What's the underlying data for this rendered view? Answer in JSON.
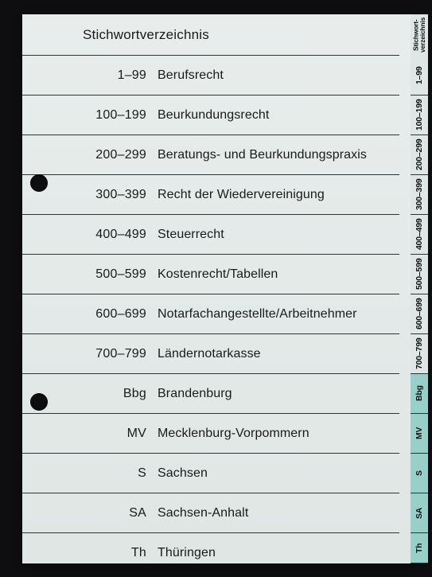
{
  "header": {
    "title": "Stichwortverzeichnis",
    "tab_label": "Stichwort-\nverzeichnis"
  },
  "rows": [
    {
      "code": "1–99",
      "desc": "Berufsrecht",
      "tab": "1–99",
      "region": false
    },
    {
      "code": "100–199",
      "desc": "Beurkundungsrecht",
      "tab": "100–199",
      "region": false
    },
    {
      "code": "200–299",
      "desc": "Beratungs- und Beurkundungspraxis",
      "tab": "200–299",
      "region": false
    },
    {
      "code": "300–399",
      "desc": "Recht der Wiedervereinigung",
      "tab": "300–399",
      "region": false
    },
    {
      "code": "400–499",
      "desc": "Steuerrecht",
      "tab": "400–499",
      "region": false
    },
    {
      "code": "500–599",
      "desc": "Kostenrecht/Tabellen",
      "tab": "500–599",
      "region": false
    },
    {
      "code": "600–699",
      "desc": "Notarfachangestellte/Arbeitnehmer",
      "tab": "600–699",
      "region": false
    },
    {
      "code": "700–799",
      "desc": "Ländernotarkasse",
      "tab": "700–799",
      "region": false
    },
    {
      "code": "Bbg",
      "desc": "Brandenburg",
      "tab": "Bbg",
      "region": true
    },
    {
      "code": "MV",
      "desc": "Mecklenburg-Vorpommern",
      "tab": "MV",
      "region": true
    },
    {
      "code": "S",
      "desc": "Sachsen",
      "tab": "S",
      "region": true
    },
    {
      "code": "SA",
      "desc": "Sachsen-Anhalt",
      "tab": "SA",
      "region": true
    },
    {
      "code": "Th",
      "desc": "Thüringen",
      "tab": "Th",
      "region": true
    }
  ]
}
